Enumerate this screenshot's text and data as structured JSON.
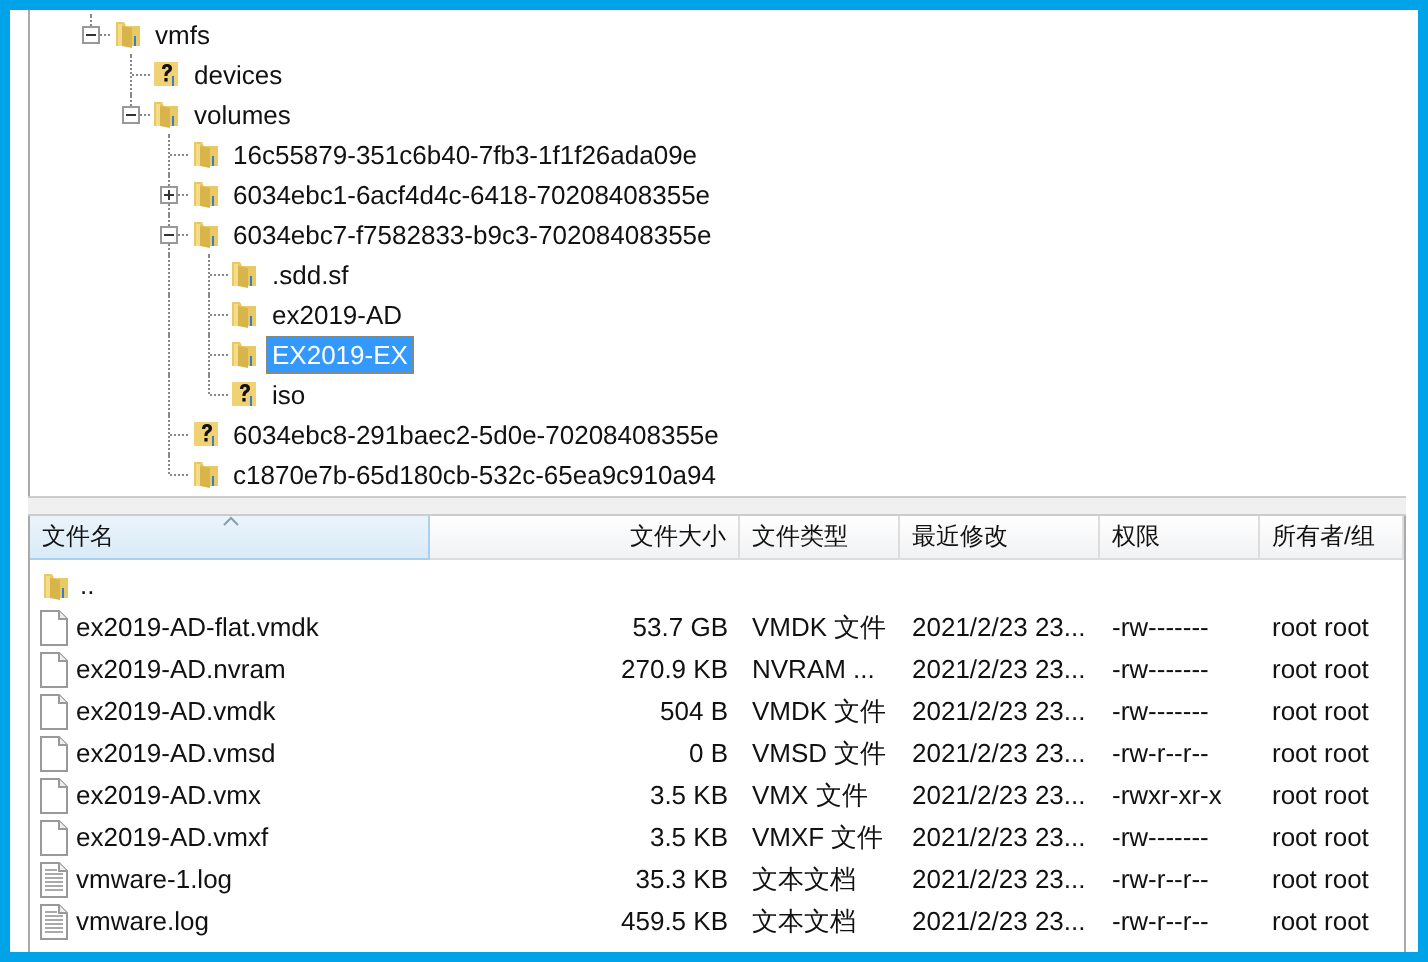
{
  "tree": [
    {
      "label": "vmfs",
      "kind": "folder",
      "expanded": true,
      "selected": false,
      "children": [
        {
          "label": "devices",
          "kind": "unknown",
          "selected": false
        },
        {
          "label": "volumes",
          "kind": "folder",
          "expanded": true,
          "selected": false,
          "children": [
            {
              "label": "16c55879-351c6b40-7fb3-1f1f26ada09e",
              "kind": "folder",
              "selected": false
            },
            {
              "label": "6034ebc1-6acf4d4c-6418-70208408355e",
              "kind": "folder",
              "expanded": false,
              "selected": false
            },
            {
              "label": "6034ebc7-f7582833-b9c3-70208408355e",
              "kind": "folder",
              "expanded": true,
              "selected": false,
              "children": [
                {
                  "label": ".sdd.sf",
                  "kind": "folder",
                  "selected": false
                },
                {
                  "label": "ex2019-AD",
                  "kind": "folder",
                  "selected": false
                },
                {
                  "label": "EX2019-EX",
                  "kind": "folder",
                  "selected": true
                },
                {
                  "label": "iso",
                  "kind": "unknown",
                  "selected": false
                }
              ]
            },
            {
              "label": "6034ebc8-291baec2-5d0e-70208408355e",
              "kind": "unknown",
              "selected": false
            },
            {
              "label": "c1870e7b-65d180cb-532c-65ea9c910a94",
              "kind": "folder",
              "selected": false
            }
          ]
        }
      ]
    }
  ],
  "file_list": {
    "columns": [
      {
        "label": "文件名",
        "sorted": true,
        "kind": "text"
      },
      {
        "label": "文件大小",
        "sorted": false,
        "kind": "number"
      },
      {
        "label": "文件类型",
        "sorted": false,
        "kind": "text"
      },
      {
        "label": "最近修改",
        "sorted": false,
        "kind": "text"
      },
      {
        "label": "权限",
        "sorted": false,
        "kind": "text"
      },
      {
        "label": "所有者/组",
        "sorted": false,
        "kind": "text"
      }
    ],
    "rows": [
      {
        "kind": "folder",
        "cells": [
          "..",
          "",
          "",
          "",
          "",
          ""
        ]
      },
      {
        "kind": "file",
        "cells": [
          "ex2019-AD-flat.vmdk",
          "53.7 GB",
          "VMDK 文件",
          "2021/2/23 23...",
          "-rw-------",
          "root root"
        ]
      },
      {
        "kind": "file",
        "cells": [
          "ex2019-AD.nvram",
          "270.9 KB",
          "NVRAM ...",
          "2021/2/23 23...",
          "-rw-------",
          "root root"
        ]
      },
      {
        "kind": "file",
        "cells": [
          "ex2019-AD.vmdk",
          "504 B",
          "VMDK 文件",
          "2021/2/23 23...",
          "-rw-------",
          "root root"
        ]
      },
      {
        "kind": "file",
        "cells": [
          "ex2019-AD.vmsd",
          "0 B",
          "VMSD 文件",
          "2021/2/23 23...",
          "-rw-r--r--",
          "root root"
        ]
      },
      {
        "kind": "file",
        "cells": [
          "ex2019-AD.vmx",
          "3.5 KB",
          "VMX 文件",
          "2021/2/23 23...",
          "-rwxr-xr-x",
          "root root"
        ]
      },
      {
        "kind": "file",
        "cells": [
          "ex2019-AD.vmxf",
          "3.5 KB",
          "VMXF 文件",
          "2021/2/23 23...",
          "-rw-------",
          "root root"
        ]
      },
      {
        "kind": "text",
        "cells": [
          "vmware-1.log",
          "35.3 KB",
          "文本文档",
          "2021/2/23 23...",
          "-rw-r--r--",
          "root root"
        ]
      },
      {
        "kind": "text",
        "cells": [
          "vmware.log",
          "459.5 KB",
          "文本文档",
          "2021/2/23 23...",
          "-rw-r--r--",
          "root root"
        ]
      }
    ]
  }
}
